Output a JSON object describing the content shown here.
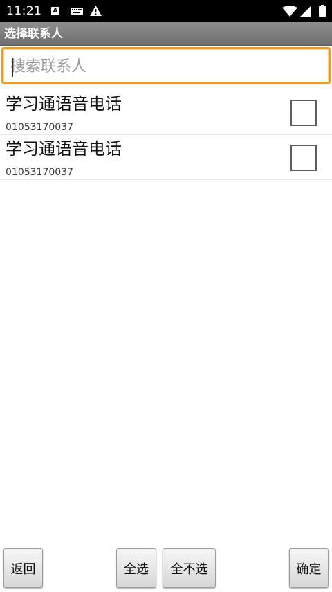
{
  "status_bar": {
    "time": "11:21",
    "icons": [
      "font-a-icon",
      "keyboard-icon",
      "warning-icon",
      "wifi-icon",
      "signal-icon",
      "battery-icon"
    ],
    "notification_letter": "A"
  },
  "title_bar": {
    "title": "选择联系人"
  },
  "search": {
    "placeholder": "搜索联系人",
    "value": "",
    "focus_color": "#f39a1f"
  },
  "contacts": [
    {
      "name": "学习通语音电话",
      "number": "01053170037",
      "checked": false
    },
    {
      "name": "学习通语音电话",
      "number": "01053170037",
      "checked": false
    }
  ],
  "buttons": {
    "back": "返回",
    "select_all": "全选",
    "select_none": "全不选",
    "confirm": "确定"
  }
}
